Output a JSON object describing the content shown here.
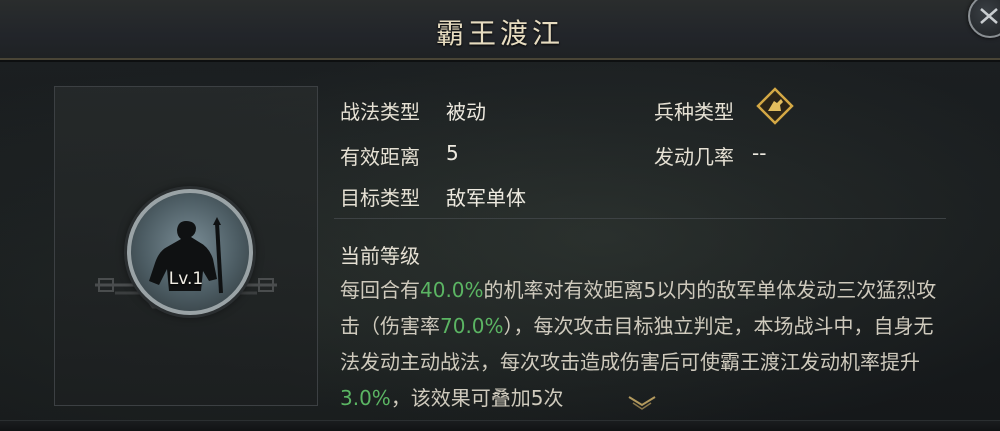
{
  "header": {
    "title": "霸王渡江"
  },
  "portrait": {
    "level": "Lv.1"
  },
  "info": {
    "tactic_type_label": "战法类型",
    "tactic_type_value": "被动",
    "range_label": "有效距离",
    "range_value": "5",
    "target_label": "目标类型",
    "target_value": "敌军单体",
    "unit_type_label": "兵种类型",
    "unit_type_icon": "cavalry-icon",
    "trigger_rate_label": "发动几率",
    "trigger_rate_value": "--"
  },
  "current_level": {
    "title": "当前等级",
    "desc_1": "每回合有",
    "desc_hl_1": "40.0%",
    "desc_2": "的机率对有效距离5以内的敌军单体发动三次猛烈攻击（伤害率",
    "desc_hl_2": "70.0%",
    "desc_3": "），每次攻击目标独立判定，本场战斗中，自身无法发动主动战法，每次攻击造成伤害后可使霸王渡江发动机率提升",
    "desc_hl_3": "3.0%",
    "desc_4": "，该效果可叠加5次"
  },
  "colors": {
    "highlight": "#5bb563",
    "title_text": "#e7dcc0",
    "gold_icon": "#d4a845"
  }
}
